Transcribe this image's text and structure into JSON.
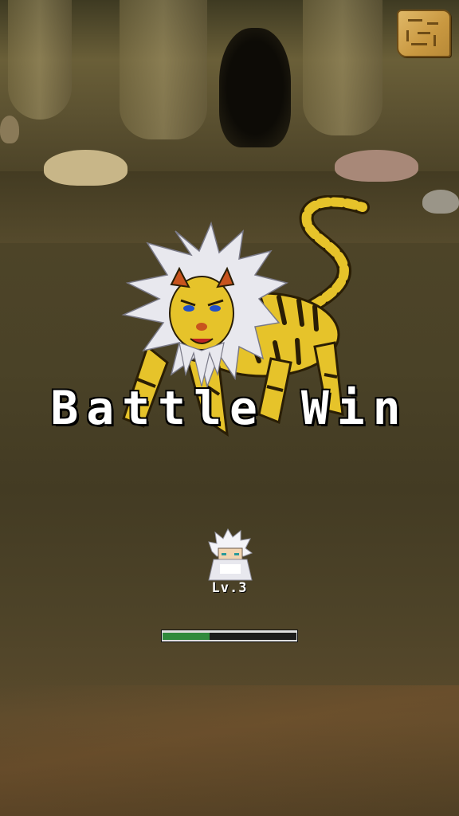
{
  "battle": {
    "result_text": "Battle Win",
    "monster_name_icon": "tiger-lion-beast",
    "hero_icon": "white-haired-hero"
  },
  "player": {
    "level_label": "Lv.3",
    "xp_progress": 0.35
  },
  "map_button": {
    "icon": "treasure-map-icon"
  },
  "colors": {
    "text": "#ffffff",
    "xp_fill": "#2f8a3c",
    "xp_track": "#1c1c1c",
    "monster_body": "#e6c32a",
    "monster_stripes": "#2a1e05"
  }
}
